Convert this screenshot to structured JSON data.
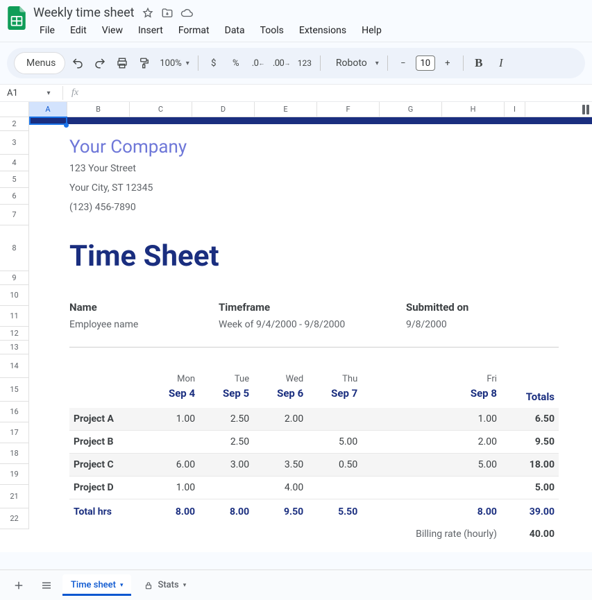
{
  "doc": {
    "title": "Weekly time sheet"
  },
  "menubar": [
    "File",
    "Edit",
    "View",
    "Insert",
    "Format",
    "Data",
    "Tools",
    "Extensions",
    "Help"
  ],
  "toolbar": {
    "menus_label": "Menus",
    "zoom": "100%",
    "font_name": "Roboto",
    "font_size": "10",
    "decimal_dec": ".0",
    "decimal_inc": ".00",
    "num_format": "123",
    "currency": "$",
    "percent": "%",
    "bold": "B",
    "italic": "I"
  },
  "namebox": {
    "cell": "A1",
    "fx": "fx",
    "formula": ""
  },
  "columns": [
    "A",
    "B",
    "C",
    "D",
    "E",
    "F",
    "G",
    "H",
    "I"
  ],
  "row_numbers": [
    "2",
    "3",
    "4",
    "5",
    "6",
    "7",
    "8",
    "9",
    "10",
    "11",
    "12",
    "13",
    "14",
    "15",
    "16",
    "17",
    "18",
    "19",
    "21",
    "22"
  ],
  "sheet": {
    "company": "Your Company",
    "addr1": "123 Your Street",
    "addr2": "Your City, ST 12345",
    "phone": "(123) 456-7890",
    "title": "Time Sheet",
    "labels": {
      "name": "Name",
      "timeframe": "Timeframe",
      "submitted": "Submitted on"
    },
    "values": {
      "name": "Employee name",
      "timeframe": "Week of 9/4/2000 - 9/8/2000",
      "submitted": "9/8/2000"
    },
    "days": [
      "Mon",
      "Tue",
      "Wed",
      "Thu",
      "Fri"
    ],
    "dates": [
      "Sep 4",
      "Sep 5",
      "Sep 6",
      "Sep 7",
      "Sep 8"
    ],
    "totals_label": "Totals",
    "projects": [
      {
        "name": "Project A",
        "hrs": [
          "1.00",
          "2.50",
          "2.00",
          "",
          "1.00"
        ],
        "total": "6.50"
      },
      {
        "name": "Project B",
        "hrs": [
          "",
          "2.50",
          "",
          "5.00",
          "2.00"
        ],
        "total": "9.50"
      },
      {
        "name": "Project C",
        "hrs": [
          "6.00",
          "3.00",
          "3.50",
          "0.50",
          "5.00"
        ],
        "total": "18.00"
      },
      {
        "name": "Project D",
        "hrs": [
          "1.00",
          "",
          "4.00",
          "",
          ""
        ],
        "total": "5.00"
      }
    ],
    "total_hrs_label": "Total hrs",
    "total_hrs": [
      "8.00",
      "8.00",
      "9.50",
      "5.50",
      "8.00"
    ],
    "grand_total": "39.00",
    "billing_label": "Billing rate (hourly)",
    "billing_rate": "40.00"
  },
  "tabs": {
    "tab1": "Time sheet",
    "tab2": "Stats"
  }
}
